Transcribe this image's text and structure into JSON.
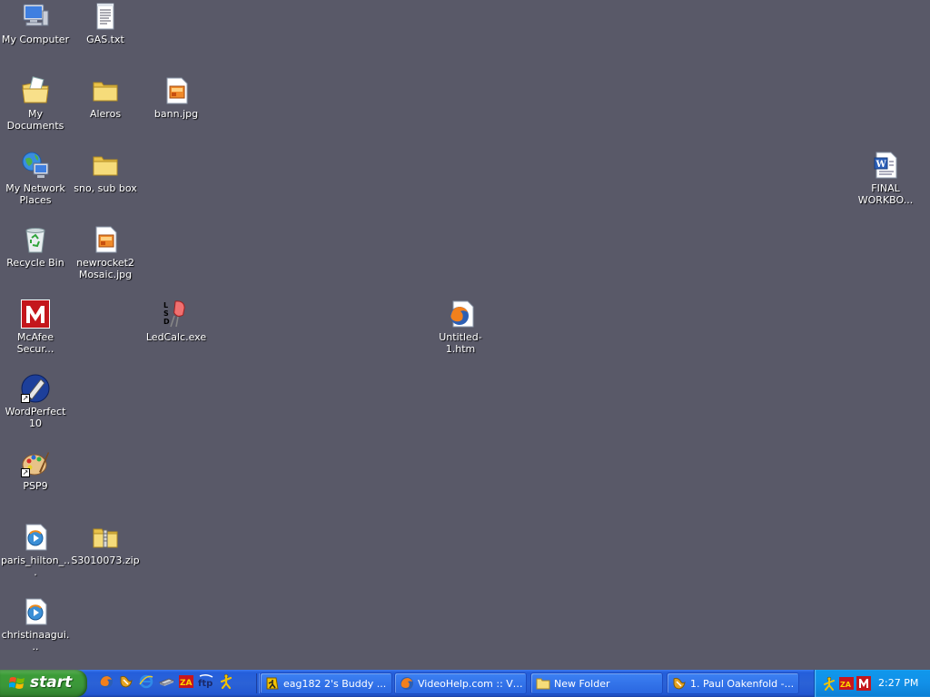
{
  "desktop": {
    "icons": [
      {
        "label": "My Computer"
      },
      {
        "label": "My Documents"
      },
      {
        "label": "My Network Places"
      },
      {
        "label": "Recycle Bin"
      },
      {
        "label": "McAfee Secur..."
      },
      {
        "label": "WordPerfect 10"
      },
      {
        "label": "PSP9"
      },
      {
        "label": "paris_hilton_..."
      },
      {
        "label": "christinaagui..."
      },
      {
        "label": "GAS.txt"
      },
      {
        "label": "Aleros"
      },
      {
        "label": "sno, sub box"
      },
      {
        "label": "newrocket2 Mosaic.jpg"
      },
      {
        "label": "S3010073.zip"
      },
      {
        "label": "bann.jpg"
      },
      {
        "label": "LedCalc.exe"
      },
      {
        "label": "Untitled-1.htm"
      },
      {
        "label": "FINAL WORKBO..."
      }
    ]
  },
  "taskbar": {
    "start_label": "start",
    "quick_launch": [
      "firefox-icon",
      "winamp-icon",
      "ie-icon",
      "scanner-icon",
      "zonealarm-icon",
      "ftp-icon",
      "aim-icon"
    ],
    "tasks": [
      {
        "label": "eag182  2's Buddy ...",
        "icon": "aim-icon"
      },
      {
        "label": "VideoHelp.com :: Vi...",
        "icon": "firefox-icon"
      },
      {
        "label": "New Folder",
        "icon": "folder-icon"
      },
      {
        "label": "1. Paul Oakenfold -...",
        "icon": "winamp-icon"
      }
    ],
    "tray_icons": [
      "aim-icon",
      "zonealarm-icon",
      "mcafee-icon"
    ],
    "clock": "2:27 PM"
  },
  "colors": {
    "desktop_bg": "#595968",
    "taskbar_blue": "#245edb",
    "start_green": "#3c9c38",
    "tray_blue": "#1290e8"
  }
}
